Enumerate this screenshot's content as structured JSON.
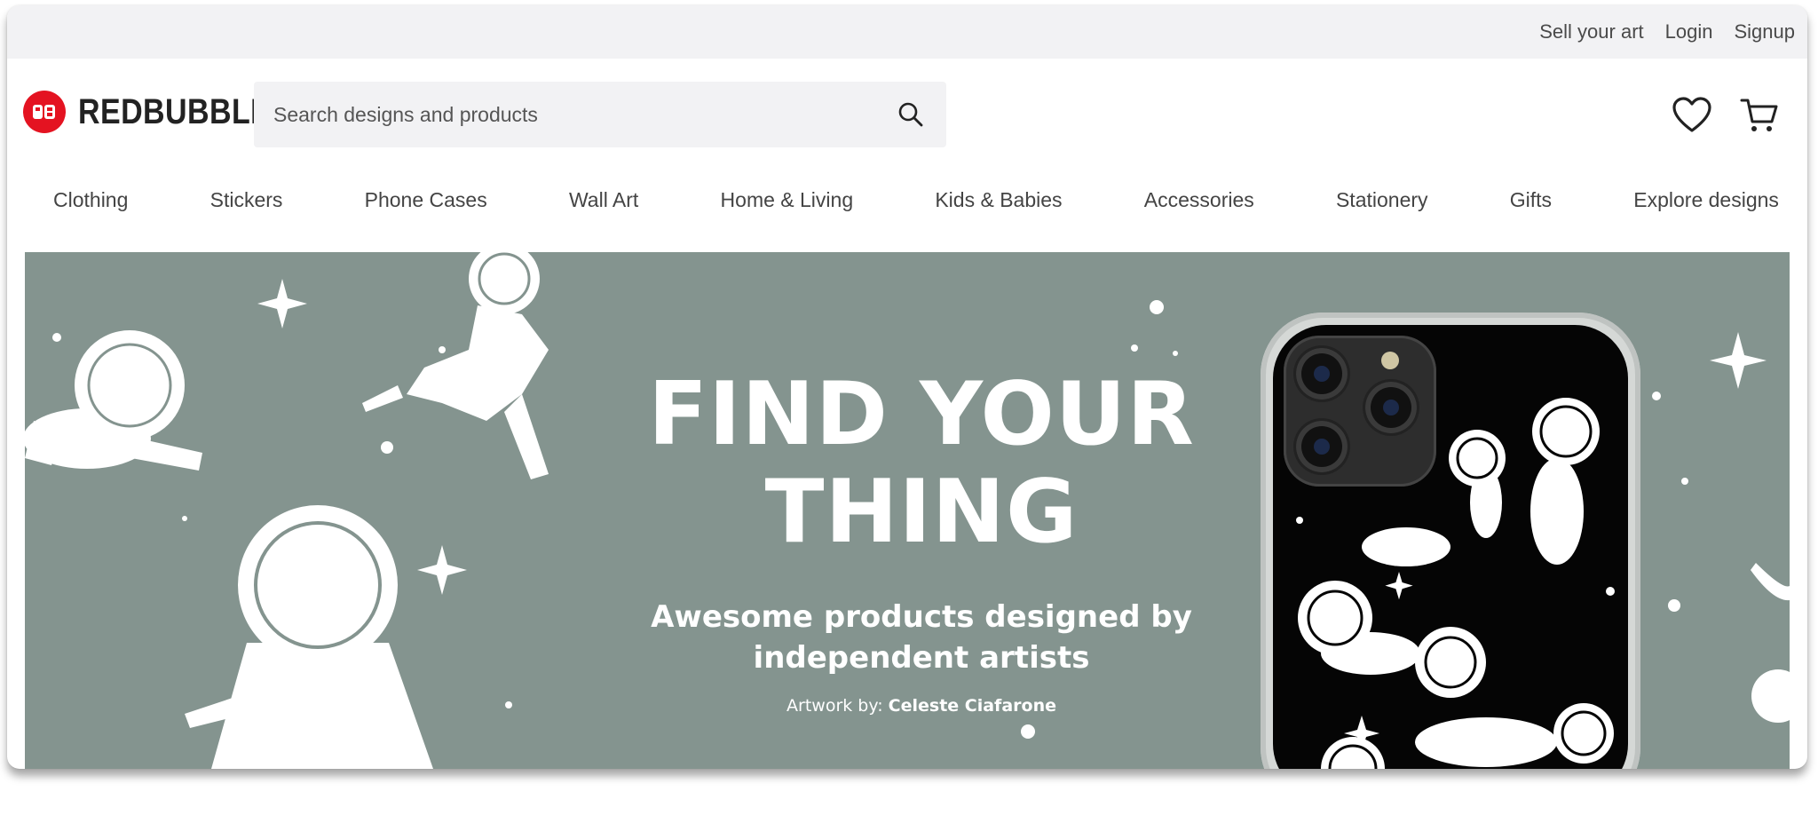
{
  "utility": {
    "sell_label": "Sell your art",
    "login_label": "Login",
    "signup_label": "Signup"
  },
  "brand": {
    "name": "REDBUBBLE",
    "color": "#e41321",
    "logo_icon": "redbubble-logo-icon"
  },
  "search": {
    "placeholder": "Search designs and products",
    "value": "",
    "icon": "search-icon"
  },
  "header_icons": [
    "heart-icon",
    "cart-icon"
  ],
  "nav": {
    "items": [
      "Clothing",
      "Stickers",
      "Phone Cases",
      "Wall Art",
      "Home & Living",
      "Kids & Babies",
      "Accessories",
      "Stationery",
      "Gifts",
      "Explore designs"
    ]
  },
  "hero": {
    "title_line1": "FIND YOUR",
    "title_line2": "THING",
    "subtitle_line1": "Awesome products designed by",
    "subtitle_line2": "independent artists",
    "credit_prefix": "Artwork by:",
    "credit_artist": "Celeste Ciafarone",
    "background_color": "#84948f"
  }
}
